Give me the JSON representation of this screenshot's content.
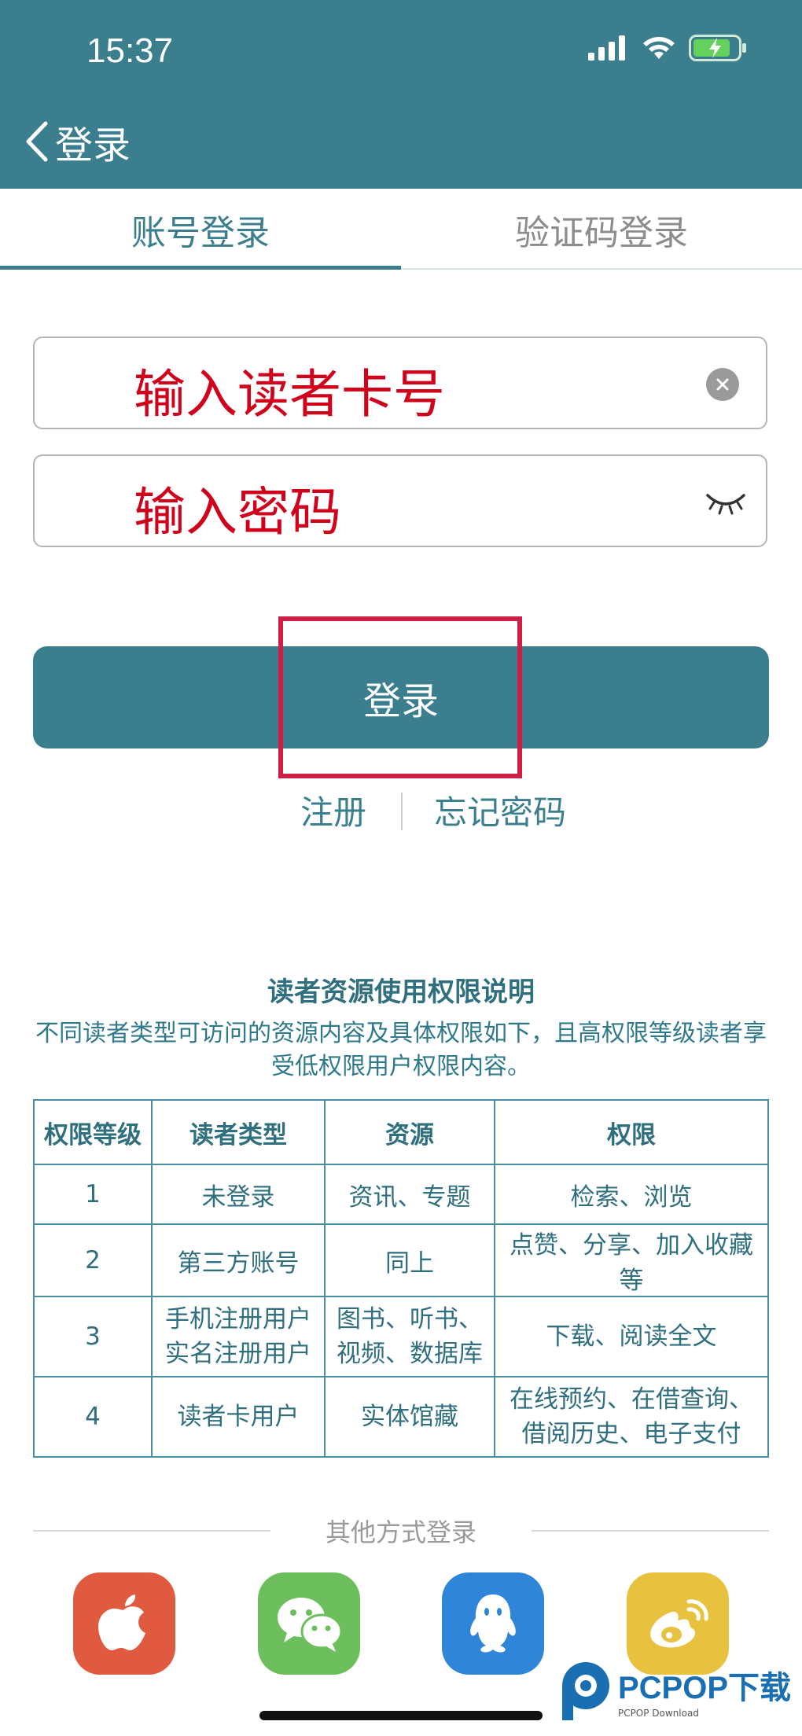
{
  "status_bar": {
    "time": "15:37"
  },
  "nav": {
    "back_title": "登录"
  },
  "tabs": {
    "account": "账号登录",
    "code": "验证码登录"
  },
  "form": {
    "card_label": "输入读者卡号",
    "password_label": "输入密码",
    "login_button": "登录"
  },
  "links": {
    "register": "注册",
    "forgot": "忘记密码"
  },
  "info": {
    "title": "读者资源使用权限说明",
    "description": "不同读者类型可访问的资源内容及具体权限如下，且高权限等级读者享受低权限用户权限内容。"
  },
  "table": {
    "headers": [
      "权限等级",
      "读者类型",
      "资源",
      "权限"
    ],
    "rows": [
      {
        "level": "1",
        "type": "未登录",
        "resource": "资讯、专题",
        "permission": "检索、浏览"
      },
      {
        "level": "2",
        "type": "第三方账号",
        "resource": "同上",
        "permission": "点赞、分享、加入收藏等"
      },
      {
        "level": "3",
        "type_l1": "手机注册用户",
        "type_l2": "实名注册用户",
        "resource_l1": "图书、听书、",
        "resource_l2": "视频、数据库",
        "permission": "下载、阅读全文"
      },
      {
        "level": "4",
        "type": "读者卡用户",
        "resource": "实体馆藏",
        "permission_l1": "在线预约、在借查询、",
        "permission_l2": "借阅历史、电子支付"
      }
    ]
  },
  "other_login": {
    "title": "其他方式登录",
    "icons": [
      "apple-icon",
      "wechat-icon",
      "qq-icon",
      "weibo-icon"
    ]
  },
  "watermark": {
    "brand": "PCPOP下载",
    "sub": "PCPOP Download"
  },
  "colors": {
    "primary": "#3b7f8f",
    "highlight": "#cc1f45",
    "input_text": "#d0021b"
  }
}
